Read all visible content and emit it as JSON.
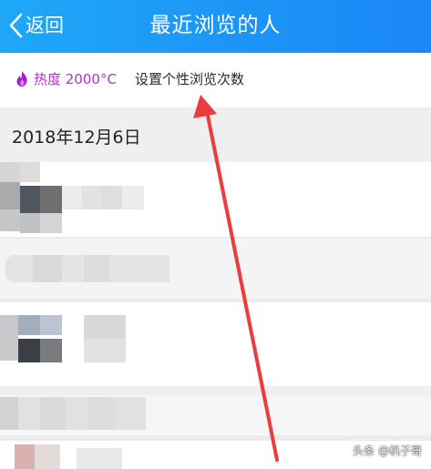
{
  "header": {
    "back_label": "返回",
    "title": "最近浏览的人"
  },
  "subbar": {
    "heat_label": "热度 2000°C",
    "setting_label": "设置个性浏览次数"
  },
  "list": {
    "date_label": "2018年12月6日"
  },
  "watermark": "头条 @机子哥",
  "colors": {
    "header_start": "#1ea8f7",
    "header_end": "#1b86f6",
    "heat_text": "#b033c9",
    "annotation_arrow": "#ee3b3b"
  }
}
